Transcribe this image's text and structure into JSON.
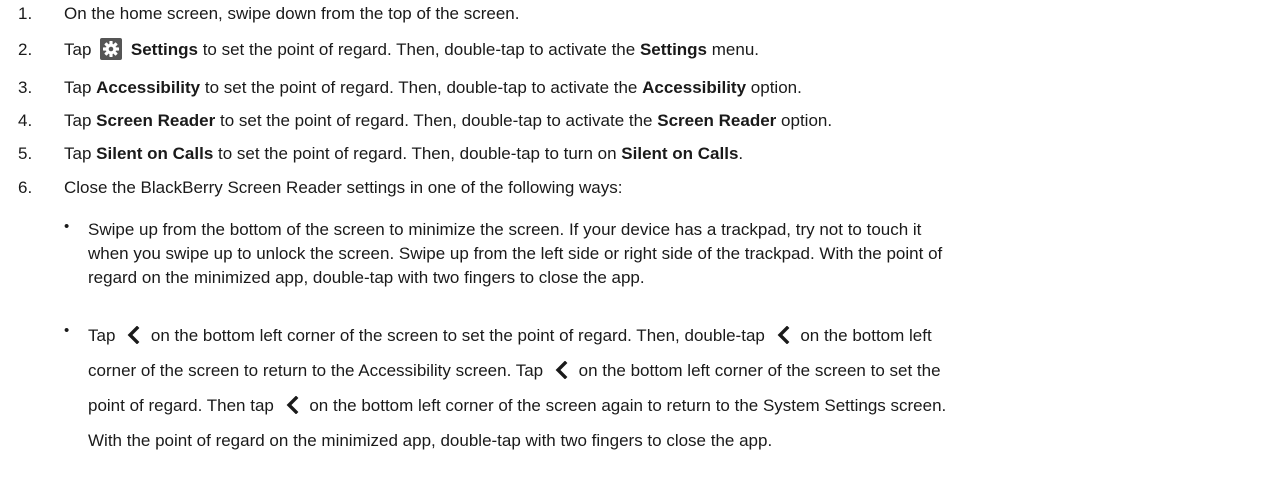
{
  "steps": [
    {
      "num": "1.",
      "text": "On the home screen, swipe down from the top of the screen."
    },
    {
      "num": "2.",
      "t1": "Tap",
      "bold1": "Settings",
      "t2": "to set the point of regard. Then, double-tap to activate the",
      "bold2": "Settings",
      "t3": "menu."
    },
    {
      "num": "3.",
      "t1": "Tap",
      "bold1": "Accessibility",
      "t2": "to set the point of regard. Then, double-tap to activate the",
      "bold2": "Accessibility",
      "t3": "option."
    },
    {
      "num": "4.",
      "t1": "Tap",
      "bold1": "Screen Reader",
      "t2": "to set the point of regard. Then, double-tap to activate the",
      "bold2": "Screen Reader",
      "t3": "option."
    },
    {
      "num": "5.",
      "t1": "Tap",
      "bold1": "Silent on Calls",
      "t2": "to set the point of regard. Then, double-tap to turn on",
      "bold2": "Silent on Calls",
      "t3": "."
    },
    {
      "num": "6.",
      "text": "Close the BlackBerry Screen Reader settings in one of the following ways:"
    }
  ],
  "bullets": [
    {
      "line1": "Swipe up from the bottom of the screen to minimize the screen. If your device has a trackpad, try not to touch it",
      "line2": "when you swipe up to unlock the screen. Swipe up from the left side or right side of the trackpad. With the point of",
      "line3": "regard on the minimized app, double-tap with two fingers to close the app."
    },
    {
      "l1a": "Tap",
      "l1b": "on the bottom left corner of the screen to set the point of regard. Then, double-tap",
      "l1c": "on the bottom left",
      "l2a": "corner of the screen to return to the Accessibility screen. Tap",
      "l2b": "on the bottom left corner of the screen to set the",
      "l3a": "point of regard. Then tap",
      "l3b": "on the bottom left corner of the screen again to return to the System Settings screen.",
      "l4": "With the point of regard on the minimized app, double-tap with two fingers to close the app."
    }
  ],
  "icons": {
    "settings": "gear-icon",
    "back": "chevron-left-icon"
  }
}
